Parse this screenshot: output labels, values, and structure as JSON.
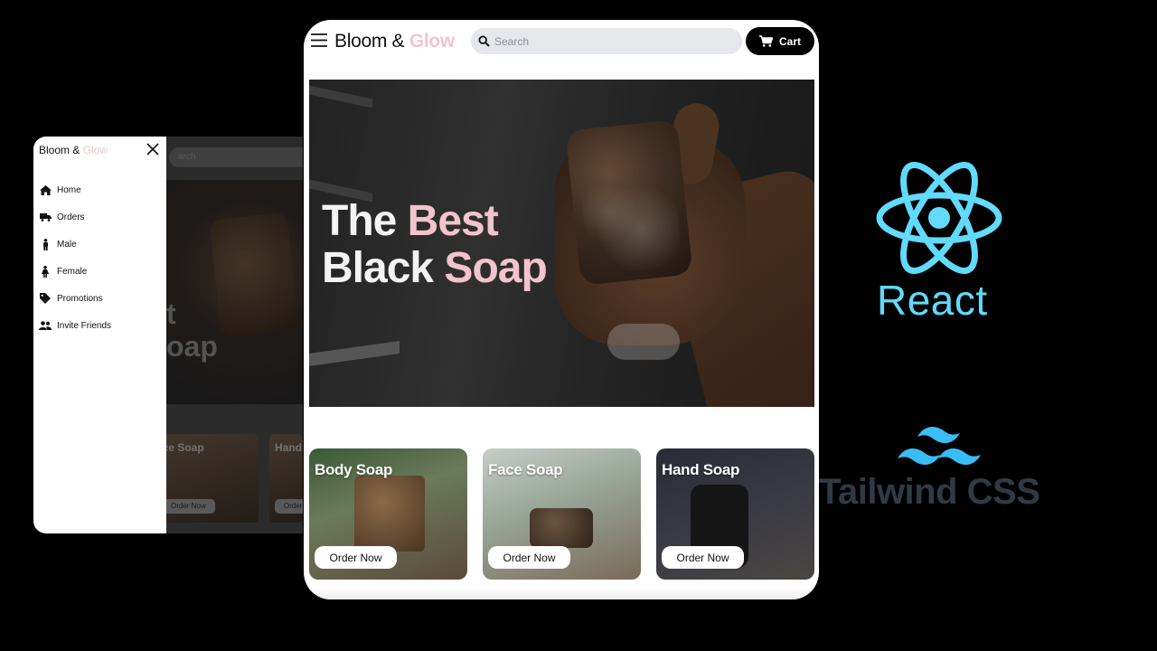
{
  "brand": {
    "name_part1": "Bloom & ",
    "name_part2": "Glow",
    "accent_color": "#f2c4cd"
  },
  "header": {
    "menu_icon": "hamburger-icon",
    "search_icon": "search-icon",
    "search_placeholder": "Search",
    "cart_label": "Cart",
    "cart_icon": "cart-icon"
  },
  "hero": {
    "line1_part1": "The ",
    "line1_part2": "Best",
    "line2_part1": "Black ",
    "line2_part2": "Soap"
  },
  "products": [
    {
      "title": "Body Soap",
      "button": "Order Now"
    },
    {
      "title": "Face Soap",
      "button": "Order Now"
    },
    {
      "title": "Hand Soap",
      "button": "Order Now"
    }
  ],
  "sidebar": {
    "close_icon": "close-icon",
    "items": [
      {
        "label": "Home",
        "icon": "home-icon"
      },
      {
        "label": "Orders",
        "icon": "truck-icon"
      },
      {
        "label": "Male",
        "icon": "male-icon"
      },
      {
        "label": "Female",
        "icon": "female-icon"
      },
      {
        "label": "Promotions",
        "icon": "tag-icon"
      },
      {
        "label": "Invite Friends",
        "icon": "users-icon"
      }
    ]
  },
  "left_background": {
    "search_text": "arch",
    "hero_text_line1": "t",
    "hero_text_line2": "oap",
    "card1_title": "ace Soap",
    "card2_title": "Hand",
    "card_button": "Order Now",
    "card_button_partial": "Order"
  },
  "logos": {
    "react_label": "React",
    "react_color": "#61dafb",
    "tailwind_label": "Tailwind CSS",
    "tailwind_color": "#38bdf8"
  }
}
